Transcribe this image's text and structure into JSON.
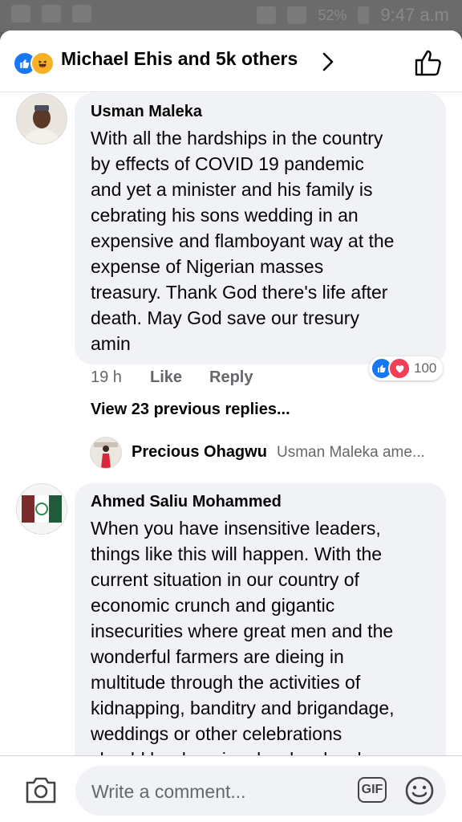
{
  "status_bar": {
    "battery": "52%",
    "time": "9:47 a.m"
  },
  "header": {
    "title": "Michael Ehis and 5k others",
    "reaction_icons": [
      "like-icon",
      "haha-icon"
    ]
  },
  "comments": [
    {
      "author": "Usman Maleka",
      "lines": [
        "With all the hardships in the country",
        "by effects of COVID 19 pandemic",
        "and yet a minister and his family is",
        "cebrating his sons wedding in an",
        "expensive and flamboyant way at the",
        "expense of Nigerian masses",
        "treasury. Thank God there's life after",
        "death. May God save our tresury",
        "amin"
      ],
      "time": "19 h",
      "like_label": "Like",
      "reply_label": "Reply",
      "reaction_count": "100",
      "view_replies": "View 23 previous replies...",
      "reply_preview": {
        "author": "Precious Ohagwu",
        "snippet": "Usman Maleka ame..."
      }
    },
    {
      "author": "Ahmed Saliu Mohammed",
      "lines": [
        "When you have insensitive leaders,",
        "things like this will happen. With the",
        "current situation in our country of",
        "economic crunch and gigantic",
        "insecurities where great men and the",
        "wonderful farmers are dieing in",
        "multitude through the activities of",
        "kidnapping, banditry and brigandage,",
        "weddings or other celebrations",
        "should be done in a low key level"
      ]
    }
  ],
  "composer": {
    "placeholder": "Write a comment...",
    "gif_label": "GIF"
  },
  "colors": {
    "brand_blue": "#1877f2",
    "love_red": "#f33e58",
    "bubble_bg": "#f0f2f5",
    "secondary_text": "#65676b"
  }
}
